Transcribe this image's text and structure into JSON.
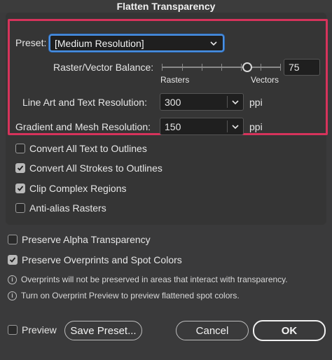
{
  "window": {
    "title": "Flatten Transparency"
  },
  "preset": {
    "label": "Preset:",
    "value": "[Medium Resolution]"
  },
  "balance": {
    "label": "Raster/Vector Balance:",
    "value": "75",
    "min_label": "Rasters",
    "max_label": "Vectors",
    "level_fraction": 0.75
  },
  "line_art": {
    "label": "Line Art and Text Resolution:",
    "value": "300",
    "unit": "ppi"
  },
  "gradient": {
    "label": "Gradient and Mesh Resolution:",
    "value": "150",
    "unit": "ppi"
  },
  "options": [
    {
      "label": "Convert All Text to Outlines",
      "checked": false
    },
    {
      "label": "Convert All Strokes to Outlines",
      "checked": true
    },
    {
      "label": "Clip Complex Regions",
      "checked": true
    },
    {
      "label": "Anti-alias Rasters",
      "checked": false
    }
  ],
  "preserve_alpha": {
    "label": "Preserve Alpha Transparency",
    "checked": false
  },
  "preserve_overprints": {
    "label": "Preserve Overprints and Spot Colors",
    "checked": true
  },
  "info": [
    "Overprints will not be preserved in areas that interact with transparency.",
    "Turn on Overprint Preview to preview flattened spot colors."
  ],
  "footer": {
    "preview_label": "Preview",
    "save_preset_label": "Save Preset...",
    "cancel_label": "Cancel",
    "ok_label": "OK"
  },
  "colors": {
    "highlight": "#d6335b",
    "focus": "#4a90e2"
  }
}
